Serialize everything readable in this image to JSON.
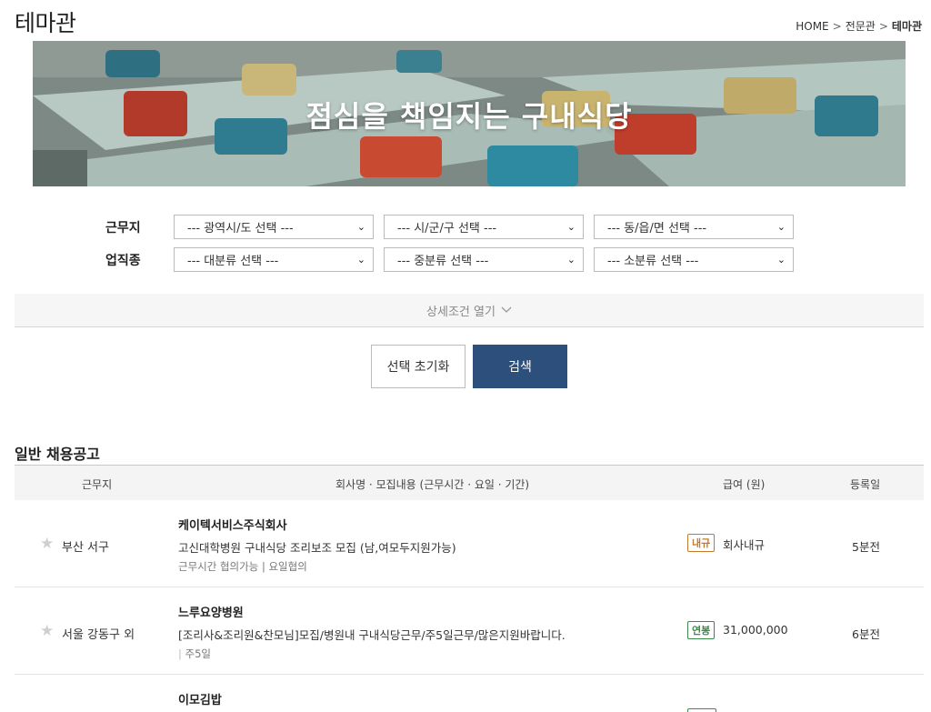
{
  "header": {
    "title": "테마관",
    "breadcrumb": [
      "HOME",
      "전문관",
      "테마관"
    ]
  },
  "banner": {
    "title": "점심을 책임지는 구내식당"
  },
  "filters": {
    "location_label": "근무지",
    "location_selects": [
      "--- 광역시/도 선택 ---",
      "--- 시/군/구 선택 ---",
      "--- 동/읍/면 선택 ---"
    ],
    "job_label": "업직종",
    "job_selects": [
      "--- 대분류 선택 ---",
      "--- 중분류 선택 ---",
      "--- 소분류 선택 ---"
    ]
  },
  "detail_toggle": {
    "label": "상세조건 열기",
    "icon": "chevron-down-icon"
  },
  "buttons": {
    "reset": "선택 초기화",
    "search": "검색"
  },
  "listing": {
    "section_title": "일반 채용공고",
    "columns": [
      "근무지",
      "회사명 · 모집내용 (근무시간 · 요일 · 기간)",
      "급여 (원)",
      "등록일"
    ],
    "rows": [
      {
        "location": "부산 서구",
        "company": "케이텍서비스주식회사",
        "description": "고신대학병원 구내식당 조리보조 모집 (남,여모두지원가능)",
        "conditions": "근무시간 협의가능 | 요일협의",
        "pay_type": "내규",
        "pay": "회사내규",
        "date": "5분전"
      },
      {
        "location": "서울 강동구 외",
        "company": "느루요양병원",
        "description": "[조리사&조리원&찬모님]모집/병원내 구내식당근무/주5일근무/많은지원바랍니다.",
        "conditions": "주5일",
        "pay_type": "연봉",
        "pay": "31,000,000",
        "date": "6분전"
      },
      {
        "company": "이모김밥"
      }
    ]
  },
  "colors": {
    "primary": "#2d4f7b",
    "badge_orange": "#c27a2c",
    "badge_green": "#3c8a4a"
  }
}
